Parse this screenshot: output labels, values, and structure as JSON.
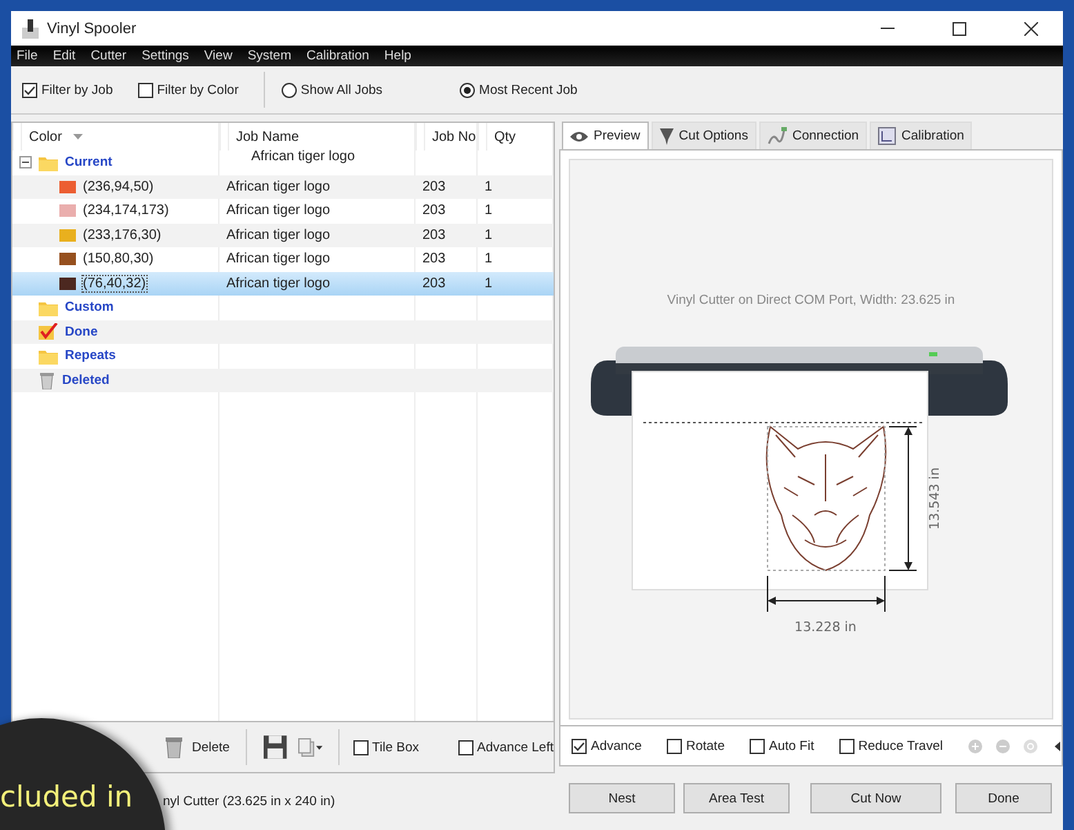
{
  "window": {
    "title": "Vinyl Spooler"
  },
  "menu": [
    "File",
    "Edit",
    "Cutter",
    "Settings",
    "View",
    "System",
    "Calibration",
    "Help"
  ],
  "filters": [
    {
      "kind": "checkbox",
      "label": "Filter by Job",
      "checked": true
    },
    {
      "kind": "checkbox",
      "label": "Filter by Color",
      "checked": false
    },
    {
      "kind": "radio",
      "label": "Show All Jobs",
      "selected": false
    },
    {
      "kind": "radio",
      "label": "Most Recent Job",
      "selected": true
    }
  ],
  "table": {
    "columns": [
      "Color",
      "Job Name",
      "Job No",
      "Qty"
    ],
    "groups": [
      {
        "label": "Current",
        "kind": "folder",
        "expanded": true,
        "job_name": "African tiger logo",
        "children": [
          {
            "label": "(236,94,50)",
            "color": "#ec5e32",
            "job_name": "African tiger logo",
            "job_no": "203",
            "qty": "1",
            "selected": false
          },
          {
            "label": "(234,174,173)",
            "color": "#eaaead",
            "job_name": "African tiger logo",
            "job_no": "203",
            "qty": "1",
            "selected": false
          },
          {
            "label": "(233,176,30)",
            "color": "#e9b01e",
            "job_name": "African tiger logo",
            "job_no": "203",
            "qty": "1",
            "selected": false
          },
          {
            "label": "(150,80,30)",
            "color": "#96501e",
            "job_name": "African tiger logo",
            "job_no": "203",
            "qty": "1",
            "selected": false
          },
          {
            "label": "(76,40,32)",
            "color": "#4c2820",
            "job_name": "African tiger logo",
            "job_no": "203",
            "qty": "1",
            "selected": true
          }
        ]
      },
      {
        "label": "Custom",
        "kind": "folder"
      },
      {
        "label": "Done",
        "kind": "check"
      },
      {
        "label": "Repeats",
        "kind": "folder"
      },
      {
        "label": "Deleted",
        "kind": "trash"
      }
    ]
  },
  "left_toolbar": {
    "delete_label": "Delete",
    "options": [
      {
        "label": "Tile Box",
        "checked": false
      },
      {
        "label": "Advance Left",
        "checked": false
      }
    ]
  },
  "status_bar": "nyl Cutter (23.625 in x 240 in)",
  "tabs": [
    {
      "label": "Preview",
      "selected": true
    },
    {
      "label": "Cut Options",
      "selected": false
    },
    {
      "label": "Connection",
      "selected": false
    },
    {
      "label": "Calibration",
      "selected": false
    }
  ],
  "preview": {
    "caption": "Vinyl Cutter on Direct COM Port, Width: 23.625 in",
    "height_label": "13.543 in",
    "width_label": "13.228 in"
  },
  "preview_options": [
    {
      "label": "Advance",
      "checked": true
    },
    {
      "label": "Rotate",
      "checked": false
    },
    {
      "label": "Auto Fit",
      "checked": false
    },
    {
      "label": "Reduce Travel",
      "checked": false
    }
  ],
  "buttons": [
    "Nest",
    "Area Test",
    "Cut Now",
    "Done"
  ],
  "overlay_caption": "cluded in"
}
